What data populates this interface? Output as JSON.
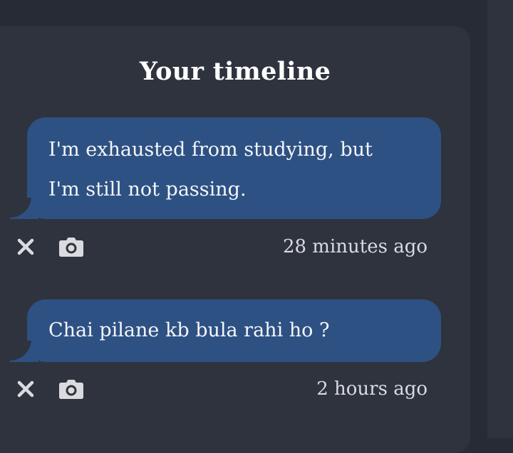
{
  "timeline": {
    "title": "Your timeline",
    "posts": [
      {
        "text": "I'm exhausted from studying, but I'm still not passing.",
        "time": "28 minutes ago",
        "icons": {
          "delete": "close-icon",
          "attach": "camera-icon"
        }
      },
      {
        "text": "Chai pilane kb bula rahi ho ?",
        "time": "2 hours ago",
        "icons": {
          "delete": "close-icon",
          "attach": "camera-icon"
        }
      }
    ]
  },
  "colors": {
    "background": "#262b35",
    "panel": "#2e333e",
    "bubble": "#2e5183",
    "bubble_text": "#f4f6fa",
    "timestamp_text": "#d8dbe1",
    "icon": "#d9dbe0"
  }
}
